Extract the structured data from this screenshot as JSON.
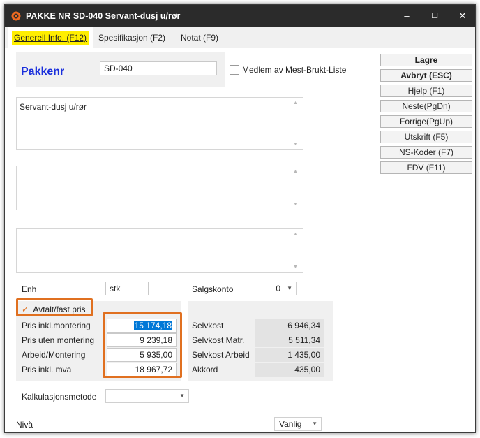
{
  "window": {
    "title": "PAKKE NR SD-040 Servant-dusj u/rør",
    "minimize": "–",
    "maximize": "☐",
    "close": "✕"
  },
  "tabs": [
    {
      "label": "Generell Info. (F12)",
      "active": true
    },
    {
      "label": "Spesifikasjon (F2)",
      "active": false
    },
    {
      "label": "Notat (F9)",
      "active": false
    }
  ],
  "header": {
    "pakkenr_label": "Pakkenr",
    "pakkenr_value": "SD-040",
    "medlem_label": "Medlem av Mest-Brukt-Liste",
    "medlem_checked": false
  },
  "description": {
    "text1": "Servant-dusj u/rør",
    "text2": "",
    "text3": ""
  },
  "buttons": [
    {
      "label": "Lagre",
      "bold": true
    },
    {
      "label": "Avbryt (ESC)",
      "bold": true
    },
    {
      "label": "Hjelp (F1)",
      "bold": false
    },
    {
      "label": "Neste(PgDn)",
      "bold": false
    },
    {
      "label": "Forrige(PgUp)",
      "bold": false
    },
    {
      "label": "Utskrift (F5)",
      "bold": false
    },
    {
      "label": "NS-Koder (F7)",
      "bold": false
    },
    {
      "label": "FDV (F11)",
      "bold": false
    }
  ],
  "unit": {
    "enh_label": "Enh",
    "enh_value": "stk",
    "salgskonto_label": "Salgskonto",
    "salgskonto_value": "0"
  },
  "pricing": {
    "fixed_label": "Avtalt/fast pris",
    "fixed_checked": true,
    "rows": [
      {
        "label": "Pris inkl.montering",
        "value": "15 174,18"
      },
      {
        "label": "Pris uten montering",
        "value": "9 239,18"
      },
      {
        "label": "Arbeid/Montering",
        "value": "5 935,00"
      },
      {
        "label": "Pris inkl. mva",
        "value": "18 967,72"
      }
    ]
  },
  "costs": {
    "rows": [
      {
        "label": "Selvkost",
        "value": "6 946,34"
      },
      {
        "label": "Selvkost Matr.",
        "value": "5 511,34"
      },
      {
        "label": "Selvkost Arbeid",
        "value": "1 435,00"
      },
      {
        "label": "Akkord",
        "value": "435,00"
      }
    ]
  },
  "kalkulasjon": {
    "label": "Kalkulasjonsmetode",
    "value": ""
  },
  "niva": {
    "label": "Nivå",
    "value": "Vanlig"
  },
  "colors": {
    "accent": "#1a2fdc",
    "highlight": "#ffee00",
    "callout": "#e07020",
    "titlebar": "#2b2b2b"
  }
}
